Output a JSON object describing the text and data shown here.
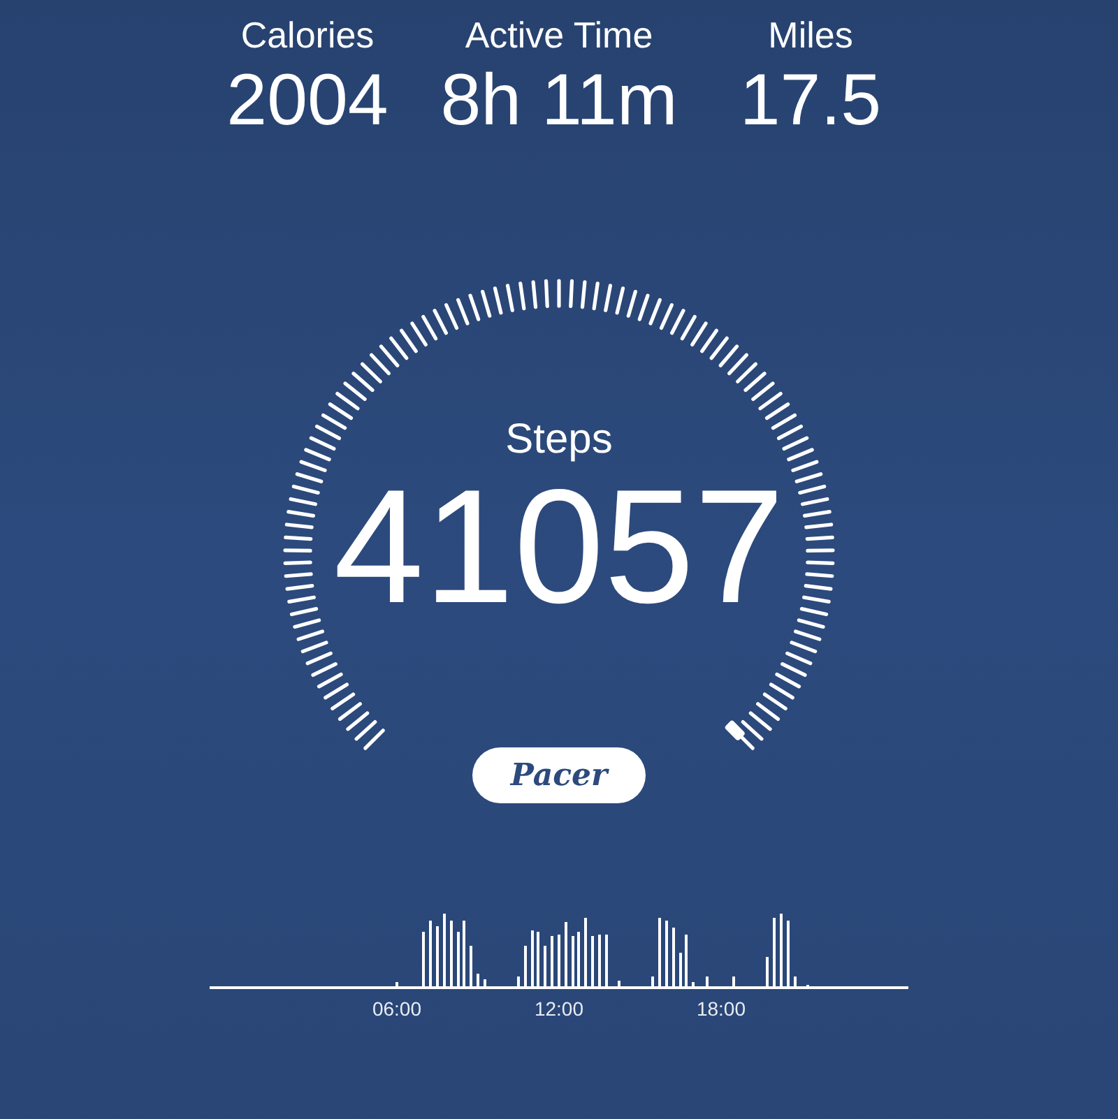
{
  "stats": [
    {
      "label": "Calories",
      "value": "2004"
    },
    {
      "label": "Active Time",
      "value": "8h 11m"
    },
    {
      "label": "Miles",
      "value": "17.5"
    }
  ],
  "gauge": {
    "label": "Steps",
    "value": "41057"
  },
  "logo": {
    "text": "Pacer"
  },
  "timeline": {
    "ticks": [
      "06:00",
      "12:00",
      "18:00"
    ]
  }
}
